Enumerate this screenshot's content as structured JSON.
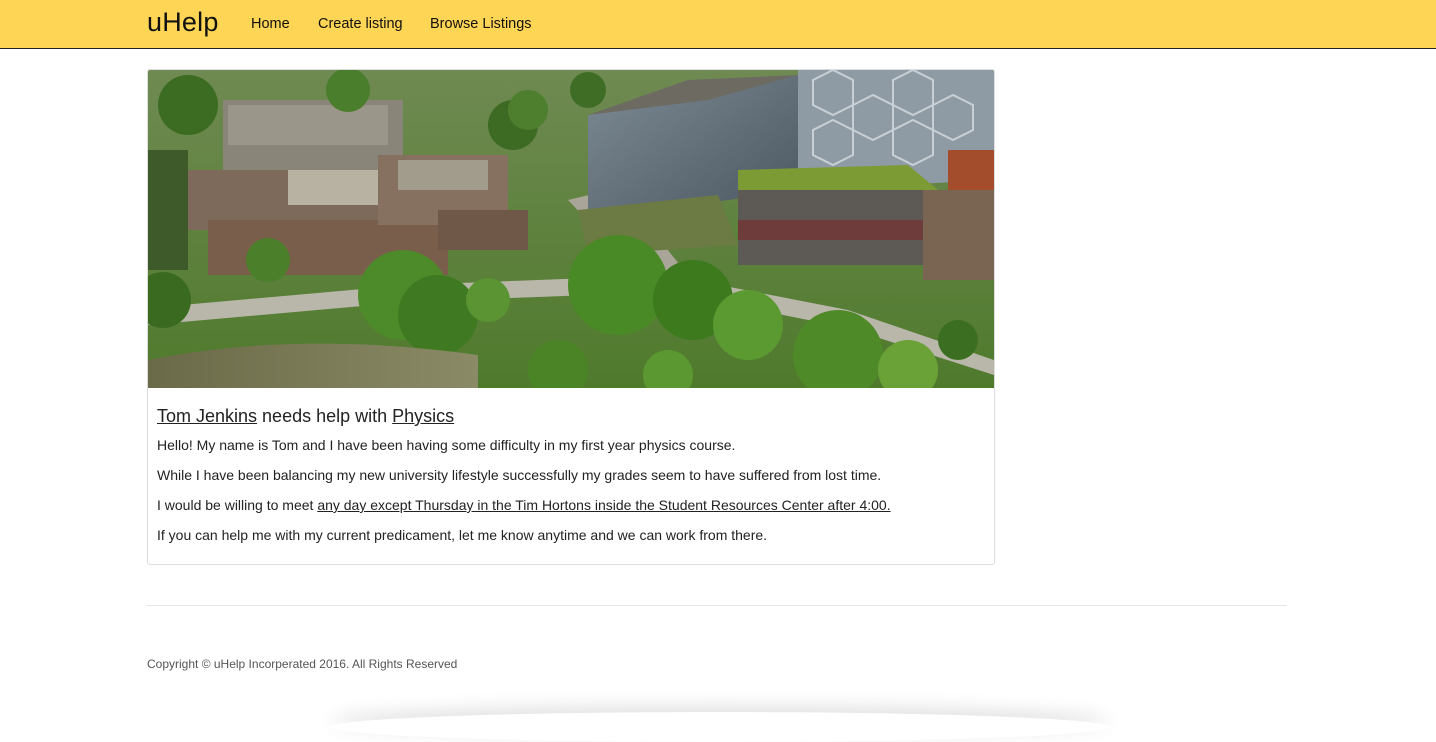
{
  "navbar": {
    "brand": "uHelp",
    "links": [
      {
        "label": "Home"
      },
      {
        "label": "Create listing"
      },
      {
        "label": "Browse Listings"
      }
    ],
    "bg_color": "#ffd555"
  },
  "listing": {
    "image_icon": "campus-aerial-photo",
    "title": {
      "person": "Tom Jenkins",
      "middle": " needs help with ",
      "subject": "Physics"
    },
    "para1": "Hello! My name is Tom and I have been having some difficulty in my first year physics course.",
    "para2": "While I have been balancing my new university lifestyle successfully my grades seem to have suffered from lost time.",
    "para3_prefix": "I would be willing to meet ",
    "para3_link": "any day except Thursday in the Tim Hortons inside the Student Resources Center after 4:00.",
    "para4": "If you can help me with my current predicament, let me know anytime and we can work from there."
  },
  "footer": {
    "copyright": "Copyright © uHelp Incorperated 2016. All Rights Reserved"
  }
}
